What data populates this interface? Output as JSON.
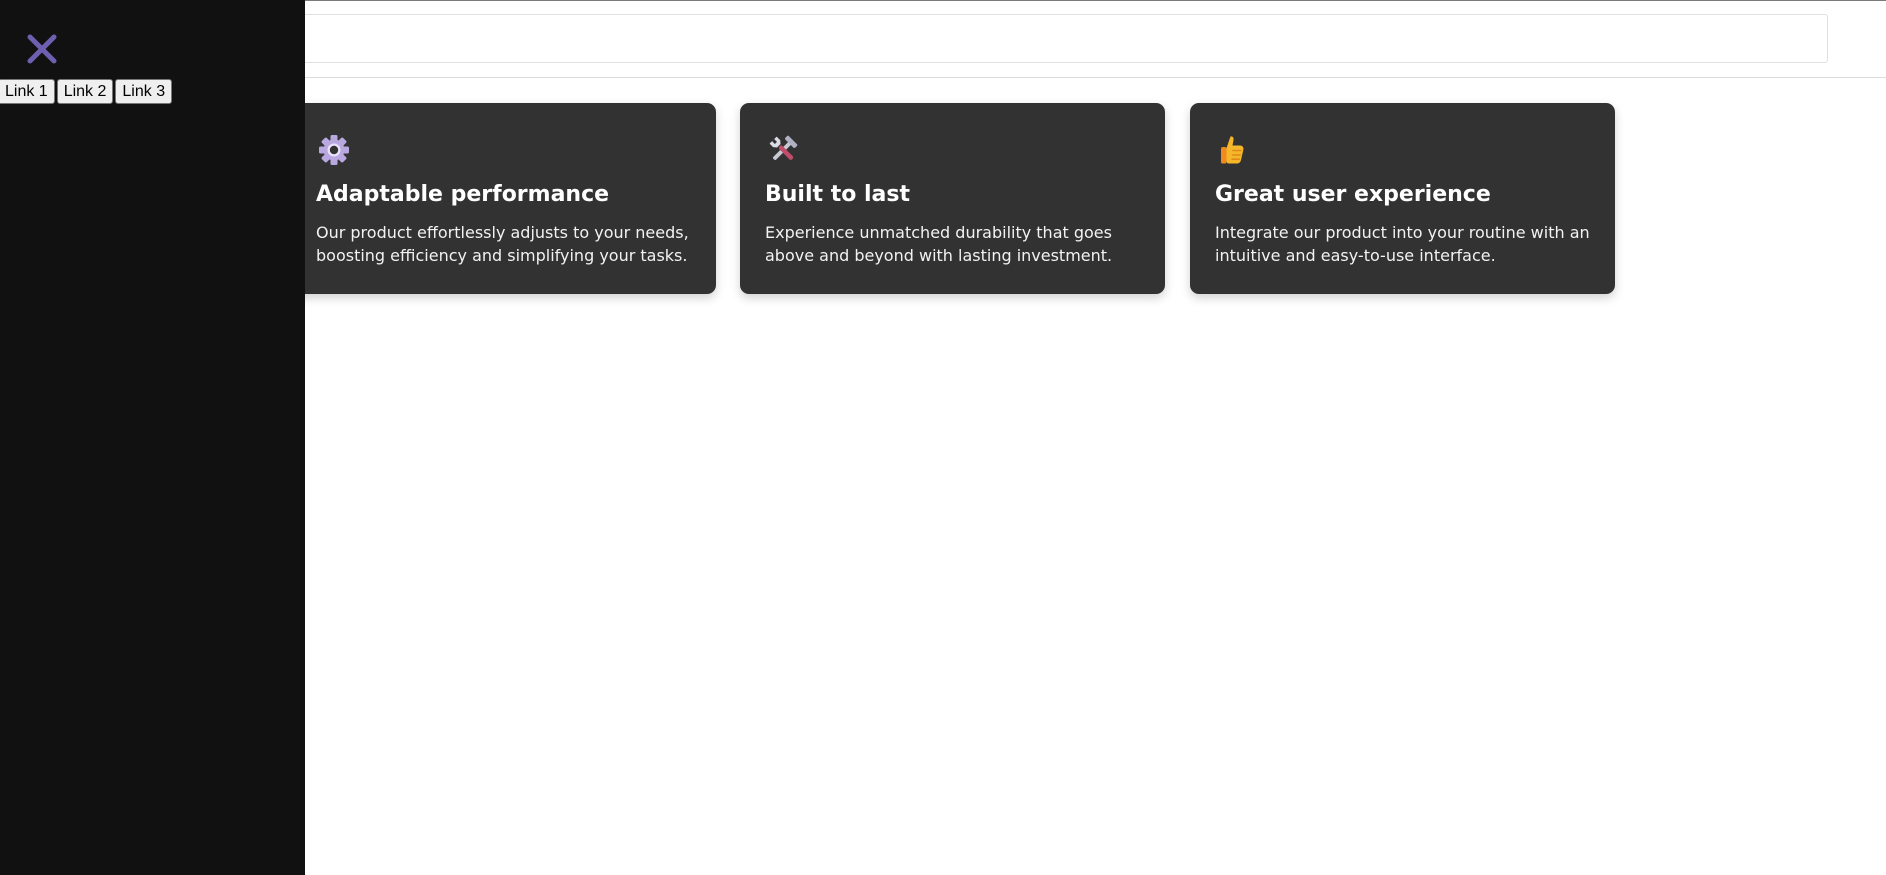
{
  "header": {
    "search_placeholder": ""
  },
  "features": [
    {
      "icon": "gear-icon",
      "title": "Adaptable performance",
      "description": "Our product effortlessly adjusts to your needs, boosting efficiency and simplifying your tasks."
    },
    {
      "icon": "tools-icon",
      "title": "Built to last",
      "description": "Experience unmatched durability that goes above and beyond with lasting investment."
    },
    {
      "icon": "thumbs-up-icon",
      "title": "Great user experience",
      "description": "Integrate our product into your routine with an intuitive and easy-to-use interface."
    }
  ],
  "sidebar": {
    "close_icon": "close-icon",
    "links": [
      "Link 1",
      "Link 2",
      "Link 3"
    ]
  },
  "colors": {
    "sidebar_background": "#111111",
    "card_background": "#323232",
    "close_icon": "#6f5fb0",
    "page_background": "#ffffff"
  }
}
